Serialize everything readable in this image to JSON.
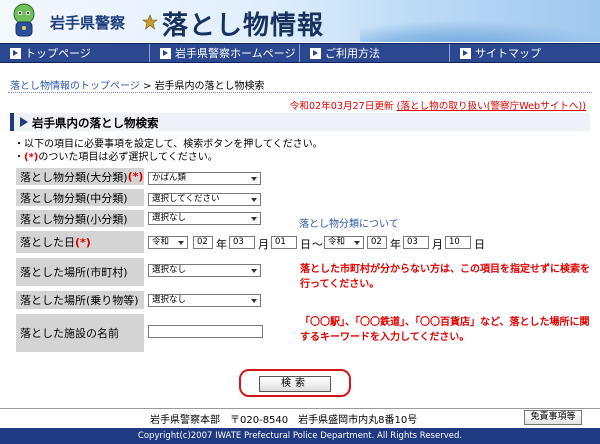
{
  "header": {
    "police_label": "岩手県警察",
    "site_title": "落とし物情報"
  },
  "nav": [
    {
      "label": "トップページ"
    },
    {
      "label": "岩手県警察ホームページ"
    },
    {
      "label": "ご利用方法"
    },
    {
      "label": "サイトマップ"
    }
  ],
  "breadcrumb": {
    "home": "落とし物情報のトップページ",
    "sep": " > ",
    "current": "岩手県内の落とし物検索"
  },
  "update": {
    "date": "令和02年03月27日更新",
    "link": "(落とし物の取り扱い(警察庁Webサイトへ))"
  },
  "heading": "岩手県内の落とし物検索",
  "notes": {
    "line1": "・以下の項目に必要事項を設定して、検索ボタンを押してください。",
    "line2_prefix": "・",
    "line2_mark": "(*)",
    "line2_text": "のついた項目は必ず選択してください。"
  },
  "form": {
    "major_label": "落とし物分類(大分類)",
    "major_mark": "(*)",
    "major_value": "かばん類",
    "middle_label": "落とし物分類(中分類)",
    "middle_value": "選択してください",
    "minor_label": "落とし物分類(小分類)",
    "minor_value": "選択なし",
    "category_link": "落とし物分類について",
    "date_label": "落とした日",
    "date_mark": "(*)",
    "from": {
      "era": "令和",
      "year": "02",
      "month": "03",
      "day": "01"
    },
    "to": {
      "era": "令和",
      "year": "02",
      "month": "03",
      "day": "10"
    },
    "unit_year": "年",
    "unit_month": "月",
    "unit_day": "日",
    "range_sep": "〜",
    "city_label": "落とした場所(市町村)",
    "city_value": "選択なし",
    "city_note": "落とした市町村が分からない方は、この項目を指定せずに検索を行ってください。",
    "vehicle_label": "落とした場所(乗り物等)",
    "vehicle_value": "選択なし",
    "facility_label": "落とした施設の名前",
    "facility_value": "",
    "facility_note": "「〇〇駅」、「〇〇鉄道」、「〇〇百貨店」など、落とした場所に関するキーワードを入力してください。"
  },
  "search_button": "検索",
  "footer": {
    "address": "岩手県警察本部　〒020-8540　岩手県盛岡市内丸8番10号",
    "disclaimer": "免責事項等",
    "copyright": "Copyright(c)2007 IWATE Prefectural Police Department. All Rights Reserved."
  }
}
